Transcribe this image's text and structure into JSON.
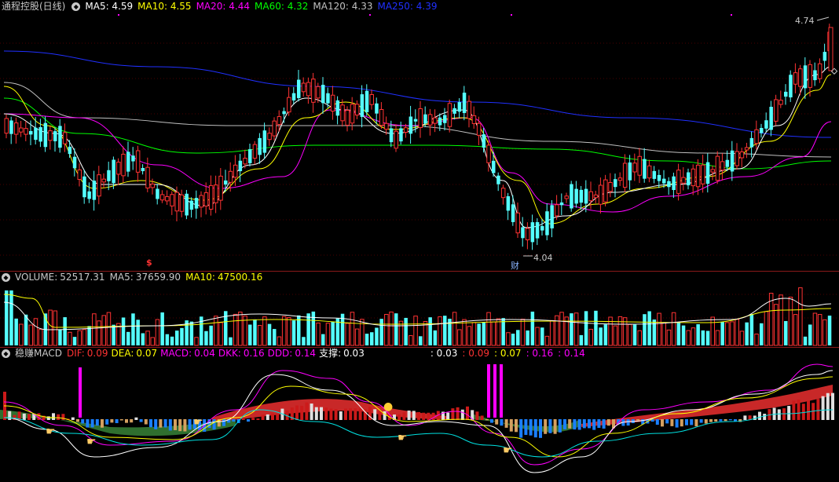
{
  "price": {
    "title": "通程控股(日线)",
    "ma": [
      {
        "label": "MA5:",
        "value": "4.59",
        "color": "#ffffff"
      },
      {
        "label": "MA10:",
        "value": "4.55",
        "color": "#ffff00"
      },
      {
        "label": "MA20:",
        "value": "4.44",
        "color": "#ff00ff"
      },
      {
        "label": "MA60:",
        "value": "4.32",
        "color": "#00ff00"
      },
      {
        "label": "MA120:",
        "value": "4.33",
        "color": "#c0c0c0"
      },
      {
        "label": "MA250:",
        "value": "4.39",
        "color": "#2030ff"
      }
    ],
    "high_label": "4.74",
    "low_label": "4.04",
    "marker_s": "$",
    "marker_cai": "财"
  },
  "volume": {
    "title": "VOLUME:",
    "value": "52517.31",
    "ma5_label": "MA5:",
    "ma5": "37659.90",
    "ma10_label": "MA10:",
    "ma10": "47500.16"
  },
  "macd": {
    "title": "稳赚MACD",
    "dif_label": "DIF:",
    "dif": "0.09",
    "dea_label": "DEA:",
    "dea": "0.07",
    "macd_label": "MACD:",
    "macd": "0.04",
    "dkk_label": "DKK:",
    "dkk": "0.16",
    "ddd_label": "DDD:",
    "ddd": "0.14",
    "zc_label": "支撑:",
    "zc": "0.03",
    "extra": [
      {
        "text": ": 0.03",
        "color": "#ffffff"
      },
      {
        "text": ": 0.09",
        "color": "#ff3333"
      },
      {
        "text": ": 0.07",
        "color": "#ffff00"
      },
      {
        "text": ": 0.16",
        "color": "#ff00ff"
      },
      {
        "text": ": 0.14",
        "color": "#ff00ff"
      }
    ]
  },
  "colors": {
    "up": "#ff3333",
    "down": "#54ffff",
    "separator": "#8a1a1a",
    "grid": "#4a0000"
  },
  "icons": [
    "circle-icon",
    "hand-pointer-icon",
    "money-bag-icon",
    "arrow-icon"
  ]
}
